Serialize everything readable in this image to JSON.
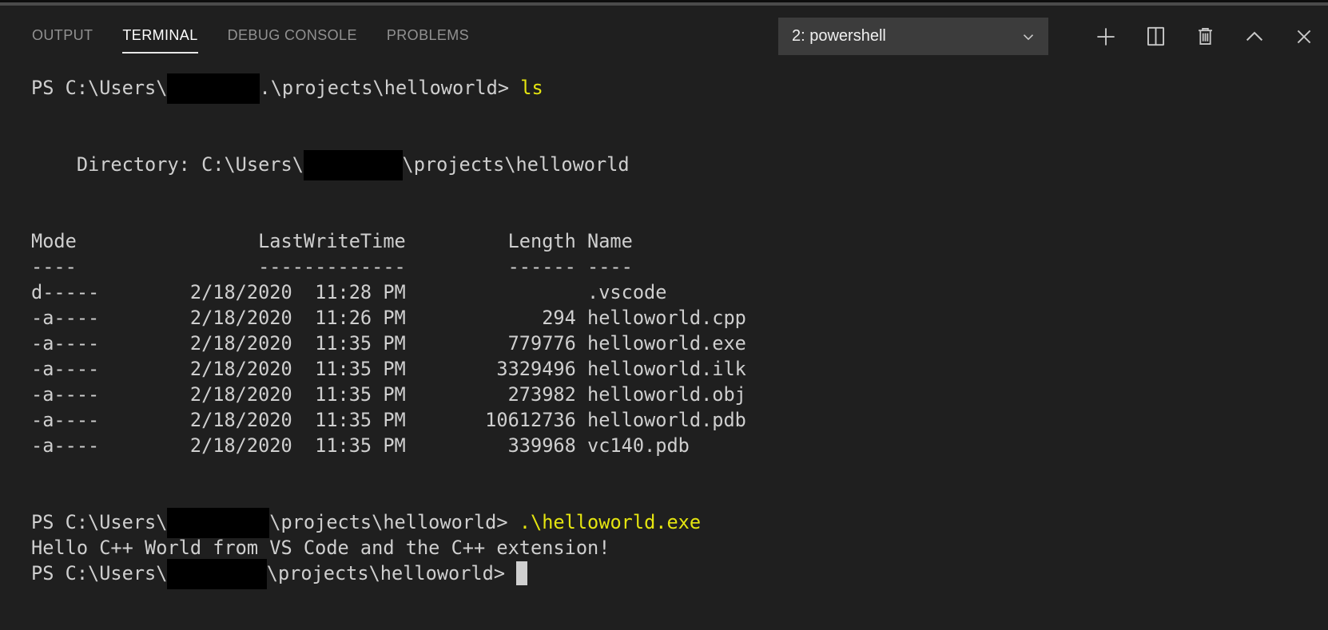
{
  "panel": {
    "tabs": [
      {
        "label": "OUTPUT",
        "active": false
      },
      {
        "label": "TERMINAL",
        "active": true
      },
      {
        "label": "DEBUG CONSOLE",
        "active": false
      },
      {
        "label": "PROBLEMS",
        "active": false
      }
    ],
    "active_tab": "TERMINAL",
    "terminal_picker": {
      "value": "2: powershell",
      "icon": "chevron-down-icon"
    },
    "action_icons": [
      {
        "name": "new-terminal",
        "glyph": "plus-icon"
      },
      {
        "name": "split-terminal",
        "glyph": "split-icon"
      },
      {
        "name": "kill-terminal",
        "glyph": "trash-icon"
      },
      {
        "name": "maximize-panel",
        "glyph": "chevron-up-icon"
      },
      {
        "name": "close-panel",
        "glyph": "close-icon"
      }
    ]
  },
  "colors": {
    "panel_bg": "#1f1f1f",
    "sash": "#4b4b4b",
    "terminal_fg": "#cfcfcf",
    "command_yellow": "#e5e510",
    "dropdown_bg": "#3c3c3c",
    "tab_inactive": "#919191",
    "tab_active": "#ffffff",
    "icon": "#c8c8c8",
    "redaction": "#000000",
    "cursor": "#cfcfcf"
  },
  "terminal": {
    "lines": [
      [
        {
          "t": "PS C:\\Users\\"
        },
        {
          "r": 8.1
        },
        {
          "t": ".\\projects\\helloworld> "
        },
        {
          "y": "ls"
        }
      ],
      [],
      [],
      [
        {
          "t": "    Directory: C:\\Users\\"
        },
        {
          "r": 8.7
        },
        {
          "t": "\\projects\\helloworld"
        }
      ],
      [],
      [],
      [
        {
          "t": "Mode                LastWriteTime         Length Name"
        }
      ],
      [
        {
          "t": "----                -------------         ------ ----"
        }
      ],
      [
        {
          "t": "d-----        2/18/2020  11:28 PM                .vscode"
        }
      ],
      [
        {
          "t": "-a----        2/18/2020  11:26 PM            294 helloworld.cpp"
        }
      ],
      [
        {
          "t": "-a----        2/18/2020  11:35 PM         779776 helloworld.exe"
        }
      ],
      [
        {
          "t": "-a----        2/18/2020  11:35 PM        3329496 helloworld.ilk"
        }
      ],
      [
        {
          "t": "-a----        2/18/2020  11:35 PM         273982 helloworld.obj"
        }
      ],
      [
        {
          "t": "-a----        2/18/2020  11:35 PM       10612736 helloworld.pdb"
        }
      ],
      [
        {
          "t": "-a----        2/18/2020  11:35 PM         339968 vc140.pdb"
        }
      ],
      [],
      [],
      [
        {
          "t": "PS C:\\Users\\"
        },
        {
          "r": 9
        },
        {
          "t": "\\projects\\helloworld> "
        },
        {
          "y": ".\\helloworld.exe"
        }
      ],
      [
        {
          "t": "Hello C++ World from VS Code and the C++ extension!"
        }
      ],
      [
        {
          "t": "PS C:\\Users\\"
        },
        {
          "r": 8.75
        },
        {
          "t": "\\projects\\helloworld> "
        },
        {
          "c": true
        }
      ]
    ]
  }
}
